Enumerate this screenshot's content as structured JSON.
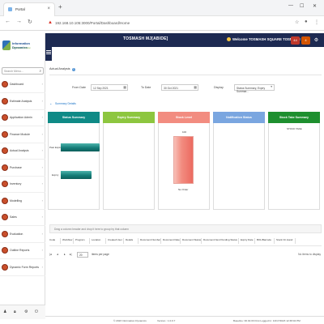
{
  "browser": {
    "tab_title": "Portal",
    "url": "192.168.10.105:3000/Portal/Dashboard/Home",
    "url_warning": "Not secure"
  },
  "app": {
    "logo_title": "Information Dynamics",
    "logo_subtitle": "A Business Solution",
    "header_title": "TOSMASH MJ[ABIDE]",
    "welcome": "Welcome TOSMASH SQUARE TOSMASH",
    "notif_badge_1": "44",
    "notif_badge_2": "4"
  },
  "sidebar": {
    "search_placeholder": "Search Menu...",
    "items": [
      {
        "label": "Dashboard"
      },
      {
        "label": "Estimate Analysis"
      },
      {
        "label": "Application Admin"
      },
      {
        "label": "Finance Module"
      },
      {
        "label": "Actual Analysis"
      },
      {
        "label": "Purchase"
      },
      {
        "label": "Inventory"
      },
      {
        "label": "Modelling"
      },
      {
        "label": "Sales"
      },
      {
        "label": "Evaluation"
      },
      {
        "label": "Outline Reports"
      },
      {
        "label": "Dynamic Form Reports"
      }
    ]
  },
  "main": {
    "breadcrumb": "Actual Analysis",
    "filters": {
      "from_label": "From Date",
      "from_value": "12 Sep 2021",
      "to_label": "To Date",
      "to_value": "30 Oct 2021",
      "display_label": "Display",
      "display_value": "Status Summary, Expiry Summar..."
    },
    "section_title": "Summary Details",
    "panels": [
      {
        "title": "Status Summary",
        "color": "#0f8a86"
      },
      {
        "title": "Expiry Summary",
        "color": "#8dc63f"
      },
      {
        "title": "Stock Level",
        "color": "#f28c80"
      },
      {
        "title": "Notification Status",
        "color": "#7aa6e0"
      },
      {
        "title": "Stock Take Summary",
        "color": "#1e8f2f"
      }
    ],
    "status_bars": [
      {
        "label": "Past Expire",
        "value": 0.48
      },
      {
        "label": "Expiry",
        "value": 0.38
      }
    ],
    "stock_level": {
      "top_label": "100",
      "bottom_label": "No Order"
    },
    "stock_take_value": "STOCK TAKE",
    "group_hint": "Drag a column header and drop it here to group by that column",
    "grid_columns": [
      "Code",
      "Workflow",
      "Program",
      "Location",
      "Created User",
      "Details",
      "Document Number",
      "Document Date",
      "Document Status",
      "Document Next Pending Status",
      "Expiry Date",
      "BOL/Barcode",
      "Stock On Hand"
    ],
    "pager": {
      "size": "20",
      "per_page": "items per page",
      "no_items": "No items to display"
    }
  },
  "footer": {
    "copyright": "© 2023 Information Dynamics",
    "version_label": "Version : 1.0.0.7",
    "dateline": "Baseline: 00.02.03  First Logged In: 10/17/2023 12:38:04 PM"
  }
}
